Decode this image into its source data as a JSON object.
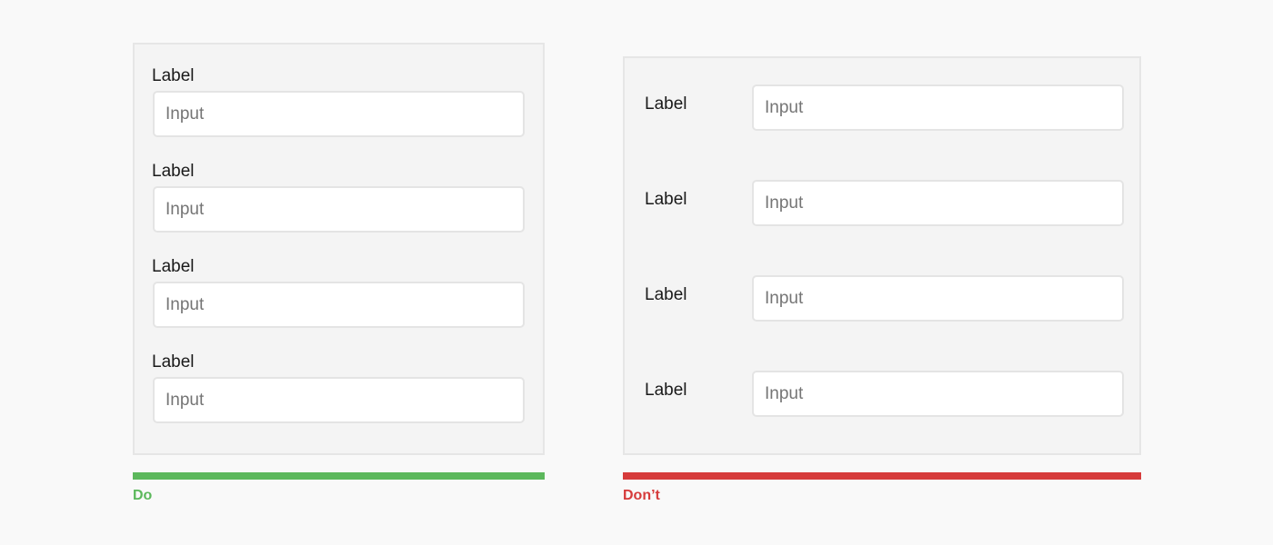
{
  "do_example": {
    "fields": [
      {
        "label": "Label",
        "placeholder": "Input"
      },
      {
        "label": "Label",
        "placeholder": "Input"
      },
      {
        "label": "Label",
        "placeholder": "Input"
      },
      {
        "label": "Label",
        "placeholder": "Input"
      }
    ],
    "caption": "Do",
    "color": "#5cb85c"
  },
  "dont_example": {
    "fields": [
      {
        "label": "Label",
        "placeholder": "Input"
      },
      {
        "label": "Label",
        "placeholder": "Input"
      },
      {
        "label": "Label",
        "placeholder": "Input"
      },
      {
        "label": "Label",
        "placeholder": "Input"
      }
    ],
    "caption": "Don’t",
    "color": "#d63b3b"
  }
}
